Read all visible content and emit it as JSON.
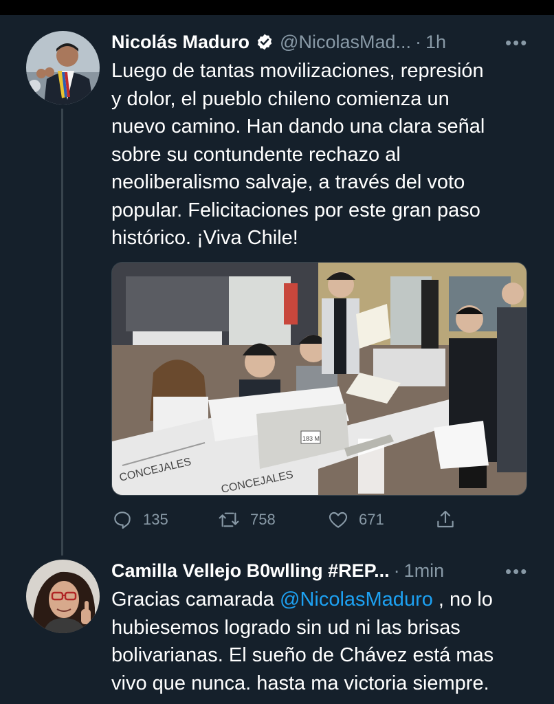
{
  "tweets": [
    {
      "name": "Nicolás Maduro",
      "verified": true,
      "handle": "@NicolasMad...",
      "time": "1h",
      "text_lines": [
        "Luego de tantas movilizaciones, represión",
        "y dolor, el pueblo chileno comienza un",
        "nuevo camino. Han dando una clara señal",
        "sobre su contundente rechazo al",
        "neoliberalismo salvaje, a través del voto",
        "popular. Felicitaciones por este gran paso",
        "histórico. ¡Viva Chile!"
      ],
      "media_labels": [
        "CONCEJALES",
        "CONCEJALES",
        "183 M"
      ],
      "replies": "135",
      "retweets": "758",
      "likes": "671",
      "icons": {
        "reply": "reply-icon",
        "retweet": "retweet-icon",
        "like": "heart-icon",
        "share": "share-icon",
        "more": "more-icon"
      }
    },
    {
      "name": "Camilla Vellejo B0wlling #REP...",
      "time": "1min",
      "text_line1_before": "Gracias camarada ",
      "mention": "@NicolasMaduro",
      "text_line1_after": " , no lo",
      "text_lines_rest": [
        "hubiesemos logrado sin ud ni las brisas",
        "bolivarianas. El sueño de Chávez está mas",
        "vivo que nunca. hasta ma victoria siempre."
      ]
    }
  ],
  "separator": "·",
  "more_glyph": "•••",
  "colors": {
    "background": "#15202b",
    "secondary": "#8899a6",
    "link": "#1da1f2",
    "border": "#38444d"
  }
}
